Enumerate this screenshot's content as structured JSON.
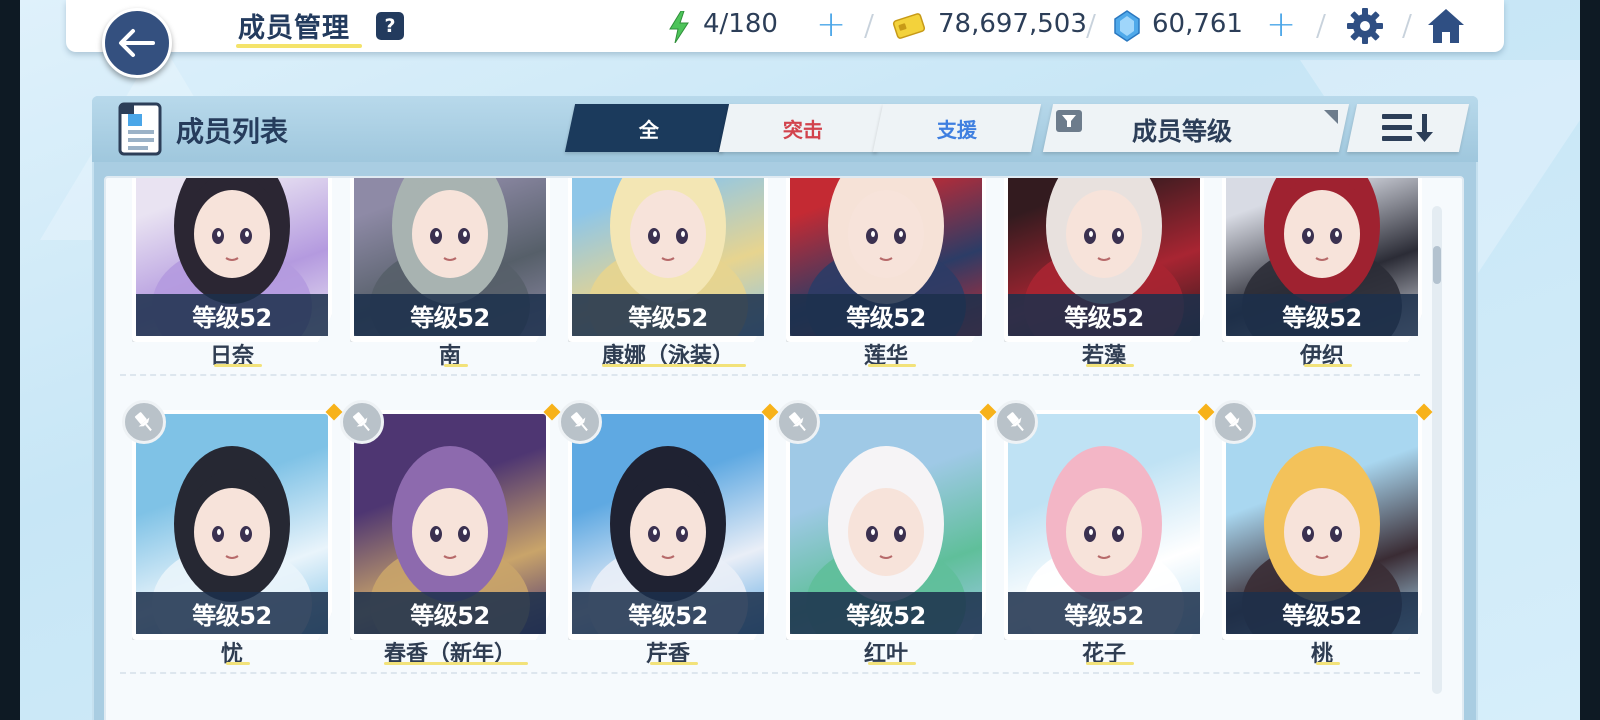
{
  "header": {
    "title": "成员管理",
    "help": "?",
    "stamina": "4/180",
    "credits": "78,697,503",
    "gems": "60,761"
  },
  "panel": {
    "title": "成员列表",
    "tabs": [
      {
        "label": "全",
        "color": "#ffffff",
        "active": true
      },
      {
        "label": "突击",
        "color": "#d2434d",
        "active": false
      },
      {
        "label": "支援",
        "color": "#3f7fe0",
        "active": false
      }
    ],
    "sort_label": "成员等级"
  },
  "members": [
    {
      "name": "日奈",
      "level": "等级52",
      "palette": [
        "#e9e3f2",
        "#2b2633",
        "#b49adf"
      ]
    },
    {
      "name": "南",
      "level": "等级52",
      "palette": [
        "#8e8aa6",
        "#a8b3b1",
        "#565f69"
      ]
    },
    {
      "name": "康娜（泳装）",
      "level": "等级52",
      "palette": [
        "#8ec6e8",
        "#f3e6b4",
        "#e7d48f"
      ]
    },
    {
      "name": "莲华",
      "level": "等级52",
      "palette": [
        "#c42a33",
        "#f6e2d7",
        "#2c3c66"
      ]
    },
    {
      "name": "若藻",
      "level": "等级52",
      "palette": [
        "#331b1f",
        "#e8e1de",
        "#a82532"
      ]
    },
    {
      "name": "伊织",
      "level": "等级52",
      "palette": [
        "#d8dbe4",
        "#9f2230",
        "#2b2c36"
      ]
    },
    {
      "name": "忧",
      "level": "等级52",
      "palette": [
        "#7fc2e6",
        "#262833",
        "#e9f4fb"
      ]
    },
    {
      "name": "春香（新年）",
      "level": "等级52",
      "palette": [
        "#4e3672",
        "#8d6aae",
        "#c9a46a"
      ]
    },
    {
      "name": "芹香",
      "level": "等级52",
      "palette": [
        "#5fa9e2",
        "#1f2232",
        "#e9eef7"
      ]
    },
    {
      "name": "红叶",
      "level": "等级52",
      "palette": [
        "#9fc9e6",
        "#f6f4f6",
        "#5fbf9a"
      ]
    },
    {
      "name": "花子",
      "level": "等级52",
      "palette": [
        "#bfe2f4",
        "#f3b6c6",
        "#ffffff"
      ]
    },
    {
      "name": "桃",
      "level": "等级52",
      "palette": [
        "#a9d7f0",
        "#f3c25a",
        "#3a2c34"
      ]
    }
  ]
}
